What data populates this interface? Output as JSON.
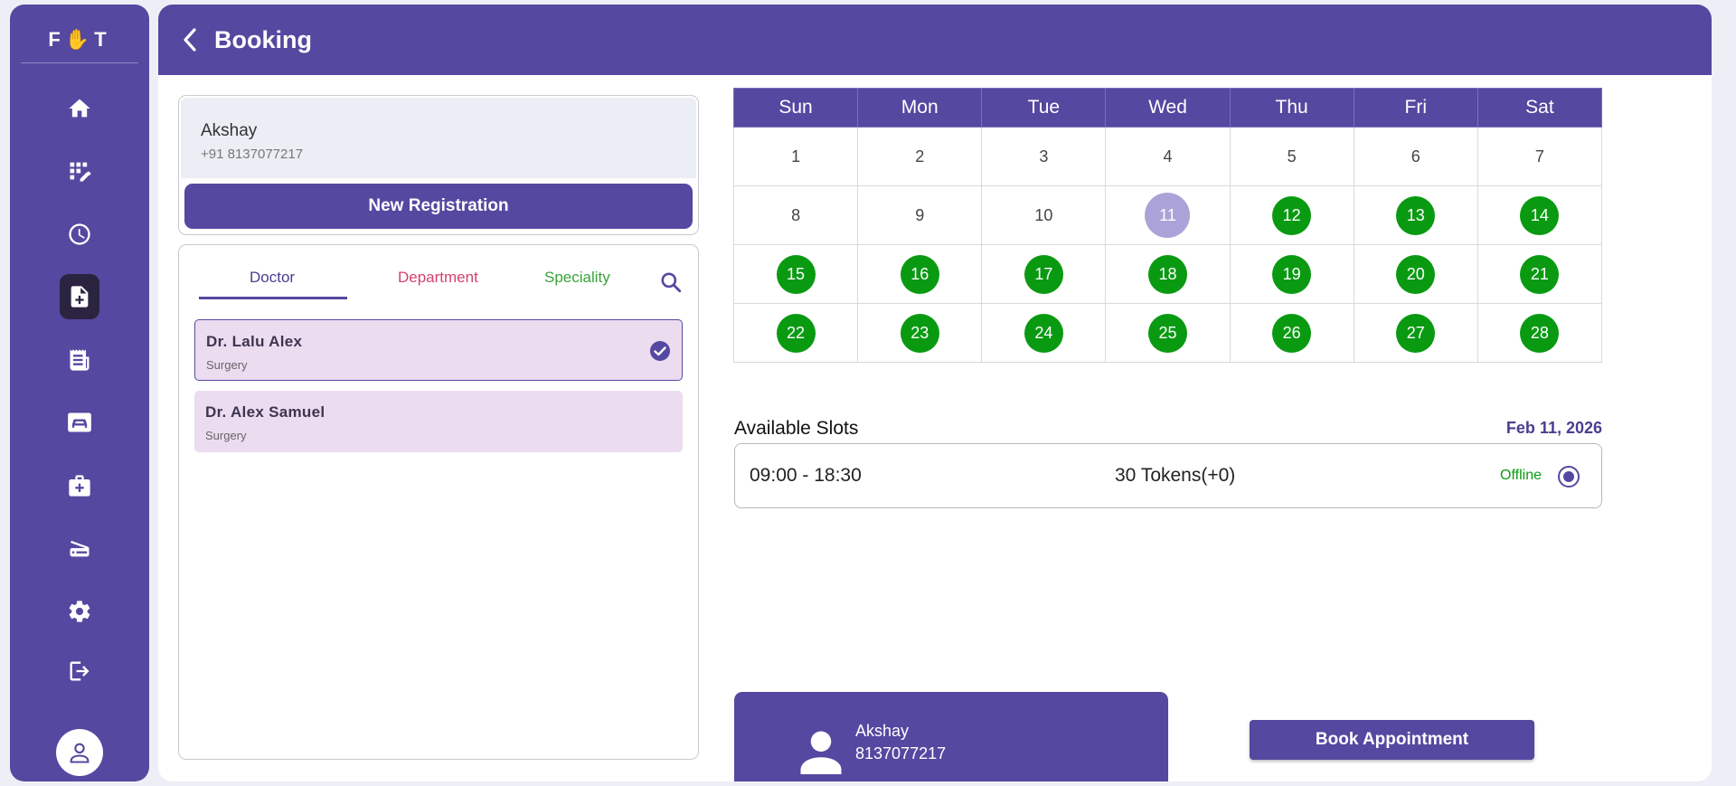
{
  "app": {
    "logo": "F✋T"
  },
  "sidebar": {
    "items": [
      {
        "name": "home",
        "icon": "home-icon"
      },
      {
        "name": "dashboard",
        "icon": "grid-edit-icon"
      },
      {
        "name": "history",
        "icon": "clock-icon"
      },
      {
        "name": "booking",
        "icon": "file-plus-icon",
        "active": true
      },
      {
        "name": "billing",
        "icon": "receipt-icon"
      },
      {
        "name": "beds",
        "icon": "bed-icon"
      },
      {
        "name": "medical",
        "icon": "medical-kit-icon"
      },
      {
        "name": "scanner",
        "icon": "scanner-icon"
      },
      {
        "name": "settings",
        "icon": "gear-icon"
      },
      {
        "name": "logout",
        "icon": "logout-icon"
      }
    ],
    "profile_icon": "user-icon"
  },
  "header": {
    "title": "Booking"
  },
  "patient": {
    "name": "Akshay",
    "phone": "+91 8137077217",
    "new_registration_label": "New Registration"
  },
  "doctor_panel": {
    "tabs": [
      "Doctor",
      "Department",
      "Speciality"
    ],
    "active_tab": "Doctor",
    "doctors": [
      {
        "name": "Dr. Lalu Alex",
        "department": "Surgery",
        "selected": true
      },
      {
        "name": "Dr. Alex Samuel",
        "department": "Surgery",
        "selected": false
      }
    ]
  },
  "calendar": {
    "weekdays": [
      "Sun",
      "Mon",
      "Tue",
      "Wed",
      "Thu",
      "Fri",
      "Sat"
    ],
    "weeks": [
      [
        "1",
        "2",
        "3",
        "4",
        "5",
        "6",
        "7"
      ],
      [
        "8",
        "9",
        "10",
        "11",
        "12",
        "13",
        "14"
      ],
      [
        "15",
        "16",
        "17",
        "18",
        "19",
        "20",
        "21"
      ],
      [
        "22",
        "23",
        "24",
        "25",
        "26",
        "27",
        "28"
      ]
    ],
    "selected_day": "11",
    "available_days": [
      "12",
      "13",
      "14",
      "15",
      "16",
      "17",
      "18",
      "19",
      "20",
      "21",
      "22",
      "23",
      "24",
      "25",
      "26",
      "27",
      "28"
    ],
    "colors": {
      "available": "#0a9a12",
      "selected": "#aba3d7"
    }
  },
  "slots": {
    "label": "Available Slots",
    "date": "Feb 11, 2026",
    "items": [
      {
        "time": "09:00 - 18:30",
        "tokens": "30 Tokens(+0)",
        "mode": "Offline",
        "selected": true
      }
    ]
  },
  "summary": {
    "name": "Akshay",
    "phone": "8137077217",
    "book_label": "Book Appointment"
  },
  "colors": {
    "primary": "#5548a0",
    "available": "#0a9a12",
    "department_tab": "#d6426a",
    "speciality_tab": "#38a33a"
  }
}
